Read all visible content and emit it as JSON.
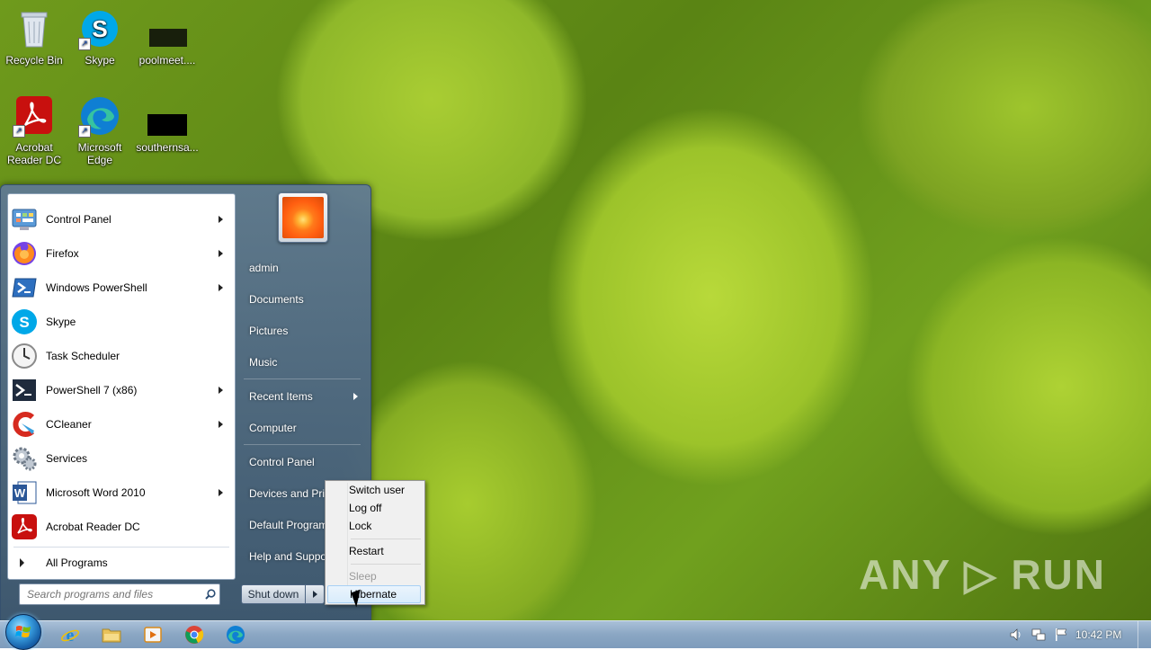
{
  "desktop": {
    "icons": [
      {
        "label": "Recycle Bin",
        "icon": "recycle-bin-icon"
      },
      {
        "label": "Skype",
        "icon": "skype-icon"
      },
      {
        "label": "poolmeet....",
        "icon": "file-icon"
      },
      {
        "label": "Acrobat Reader DC",
        "icon": "acrobat-icon"
      },
      {
        "label": "Microsoft Edge",
        "icon": "edge-icon"
      },
      {
        "label": "southernsa...",
        "icon": "file-icon"
      }
    ],
    "watermark": "ANY ▷ RUN"
  },
  "start_menu": {
    "programs": [
      {
        "label": "Control Panel",
        "icon": "control-panel-icon",
        "has_submenu": true
      },
      {
        "label": "Firefox",
        "icon": "firefox-icon",
        "has_submenu": true
      },
      {
        "label": "Windows PowerShell",
        "icon": "powershell-icon",
        "has_submenu": true
      },
      {
        "label": "Skype",
        "icon": "skype-icon",
        "has_submenu": false
      },
      {
        "label": "Task Scheduler",
        "icon": "task-scheduler-icon",
        "has_submenu": false
      },
      {
        "label": "PowerShell 7 (x86)",
        "icon": "powershell7-icon",
        "has_submenu": true
      },
      {
        "label": "CCleaner",
        "icon": "ccleaner-icon",
        "has_submenu": true
      },
      {
        "label": "Services",
        "icon": "services-icon",
        "has_submenu": false
      },
      {
        "label": "Microsoft Word 2010",
        "icon": "word-icon",
        "has_submenu": true
      },
      {
        "label": "Acrobat Reader DC",
        "icon": "acrobat-icon",
        "has_submenu": false
      }
    ],
    "all_programs": "All Programs",
    "search_placeholder": "Search programs and files",
    "right_items": [
      {
        "label": "admin",
        "has_submenu": false
      },
      {
        "label": "Documents",
        "has_submenu": false
      },
      {
        "label": "Pictures",
        "has_submenu": false
      },
      {
        "label": "Music",
        "has_submenu": false
      },
      {
        "label": "Recent Items",
        "has_submenu": true
      },
      {
        "label": "Computer",
        "has_submenu": false
      },
      {
        "label": "Control Panel",
        "has_submenu": false
      },
      {
        "label": "Devices and Printers",
        "has_submenu": false
      },
      {
        "label": "Default Programs",
        "has_submenu": false
      },
      {
        "label": "Help and Support",
        "has_submenu": false
      }
    ],
    "shutdown_label": "Shut down"
  },
  "power_menu": {
    "items": [
      {
        "label": "Switch user",
        "enabled": true
      },
      {
        "label": "Log off",
        "enabled": true
      },
      {
        "label": "Lock",
        "enabled": true
      },
      {
        "label": "Restart",
        "enabled": true
      },
      {
        "label": "Sleep",
        "enabled": false
      },
      {
        "label": "Hibernate",
        "enabled": true,
        "hovered": true
      }
    ]
  },
  "taskbar": {
    "pinned": [
      "internet-explorer-icon",
      "file-explorer-icon",
      "media-player-icon",
      "chrome-icon",
      "edge-icon"
    ],
    "tray": [
      "volume-icon",
      "network-icon",
      "action-center-flag-icon"
    ],
    "clock": "10:42 PM"
  }
}
